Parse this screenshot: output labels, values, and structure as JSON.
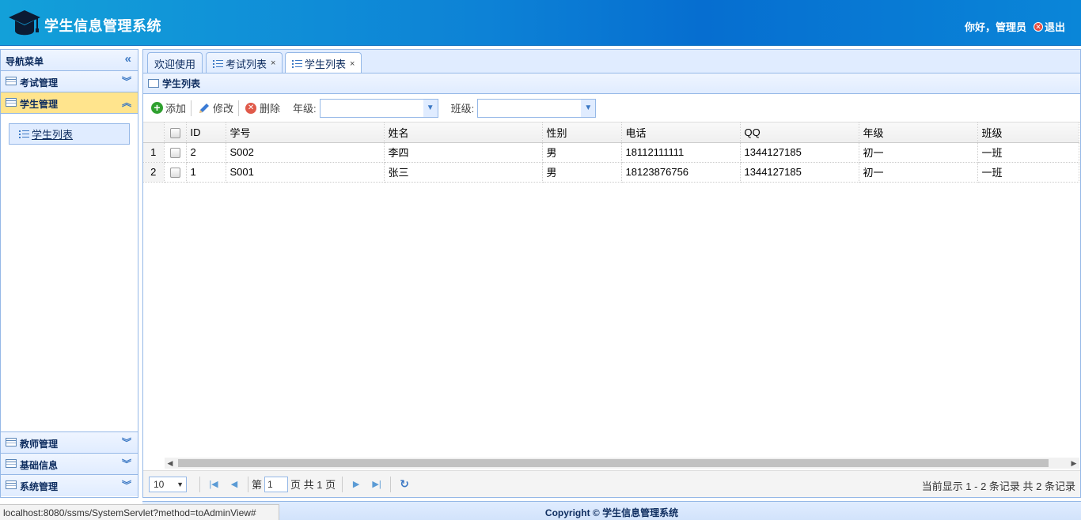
{
  "header": {
    "title": "学生信息管理系统",
    "greeting": "你好，管理员",
    "logout_label": "退出",
    "logo_icon": "graduation-cap-icon"
  },
  "sidebar": {
    "title": "导航菜单",
    "sections": [
      {
        "label": "考试管理",
        "expanded": false
      },
      {
        "label": "学生管理",
        "expanded": true,
        "items": [
          {
            "label": "学生列表"
          }
        ]
      },
      {
        "label": "教师管理",
        "expanded": false
      },
      {
        "label": "基础信息",
        "expanded": false
      },
      {
        "label": "系统管理",
        "expanded": false
      }
    ]
  },
  "tabs": [
    {
      "label": "欢迎使用",
      "closable": false,
      "active": false
    },
    {
      "label": "考试列表",
      "closable": true,
      "active": false
    },
    {
      "label": "学生列表",
      "closable": true,
      "active": true
    }
  ],
  "panel": {
    "title": "学生列表",
    "toolbar": {
      "add_label": "添加",
      "edit_label": "修改",
      "delete_label": "删除",
      "grade_label": "年级:",
      "class_label": "班级:"
    }
  },
  "grid": {
    "columns": [
      "ID",
      "学号",
      "姓名",
      "性别",
      "电话",
      "QQ",
      "年级",
      "班级"
    ],
    "rows": [
      {
        "num": "1",
        "id": "2",
        "sn": "S002",
        "name": "李四",
        "sex": "男",
        "phone": "18112111111",
        "qq": "1344127185",
        "grade": "初一",
        "clazz": "一班"
      },
      {
        "num": "2",
        "id": "1",
        "sn": "S001",
        "name": "张三",
        "sex": "男",
        "phone": "18123876756",
        "qq": "1344127185",
        "grade": "初一",
        "clazz": "一班"
      }
    ]
  },
  "pager": {
    "page_size": "10",
    "page_prefix": "第",
    "page_value": "1",
    "page_suffix": "页 共 1 页",
    "info": "当前显示 1 - 2 条记录 共 2 条记录"
  },
  "statusbar": {
    "url": "localhost:8080/ssms/SystemServlet?method=toAdminView#"
  },
  "footer": {
    "copyright": "Copyright © 学生信息管理系统"
  },
  "colors": {
    "header_start": "#13a0d9",
    "header_end": "#066ed0",
    "border": "#95b8e7",
    "panel_bg": "#e0ecff",
    "selected": "#ffe48d"
  }
}
